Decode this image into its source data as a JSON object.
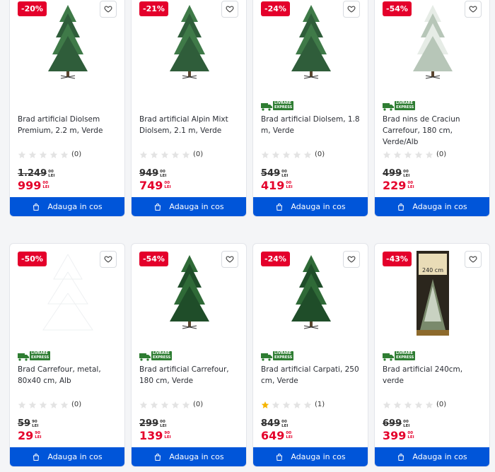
{
  "products": [
    {
      "discount": "-20%",
      "title": "Brad artificial Diolsem Premium, 2.2 m, Verde",
      "delivery": false,
      "rating": 0,
      "reviews": "(0)",
      "old_int": "1.249",
      "old_dec": "00",
      "new_int": "999",
      "new_dec": "00",
      "currency": "LEI",
      "cart_label": "Adauga in cos",
      "image": "green-fir"
    },
    {
      "discount": "-21%",
      "title": "Brad artificial Alpin Mixt Diolsem, 2.1 m, Verde",
      "delivery": false,
      "rating": 0,
      "reviews": "(0)",
      "old_int": "949",
      "old_dec": "00",
      "new_int": "749",
      "new_dec": "00",
      "currency": "LEI",
      "cart_label": "Adauga in cos",
      "image": "green-fir"
    },
    {
      "discount": "-24%",
      "title": "Brad artificial Diolsem, 1.8 m, Verde",
      "delivery": true,
      "rating": 0,
      "reviews": "(0)",
      "old_int": "549",
      "old_dec": "00",
      "new_int": "419",
      "new_dec": "00",
      "currency": "LEI",
      "cart_label": "Adauga in cos",
      "image": "green-fir"
    },
    {
      "discount": "-54%",
      "title": "Brad nins de Craciun Carrefour, 180 cm, Verde/Alb",
      "delivery": true,
      "rating": 0,
      "reviews": "(0)",
      "old_int": "499",
      "old_dec": "00",
      "new_int": "229",
      "new_dec": "00",
      "currency": "LEI",
      "cart_label": "Adauga in cos",
      "image": "snow-fir"
    },
    {
      "discount": "-50%",
      "title": "Brad Carrefour, metal, 80x40 cm, Alb",
      "delivery": true,
      "rating": 0,
      "reviews": "(0)",
      "old_int": "59",
      "old_dec": "90",
      "new_int": "29",
      "new_dec": "90",
      "currency": "LEI",
      "cart_label": "Adauga in cos",
      "image": "metal-tree"
    },
    {
      "discount": "-54%",
      "title": "Brad artificial Carrefour, 180 cm, Verde",
      "delivery": true,
      "rating": 0,
      "reviews": "(0)",
      "old_int": "299",
      "old_dec": "00",
      "new_int": "139",
      "new_dec": "90",
      "currency": "LEI",
      "cart_label": "Adauga in cos",
      "image": "dark-fir"
    },
    {
      "discount": "-24%",
      "title": "Brad artificial Carpati, 250 cm, Verde",
      "delivery": true,
      "rating": 1,
      "reviews": "(1)",
      "old_int": "849",
      "old_dec": "00",
      "new_int": "649",
      "new_dec": "00",
      "currency": "LEI",
      "cart_label": "Adauga in cos",
      "image": "dark-fir"
    },
    {
      "discount": "-43%",
      "title": "Brad artificial 240cm, verde",
      "delivery": true,
      "rating": 0,
      "reviews": "(0)",
      "old_int": "699",
      "old_dec": "00",
      "new_int": "399",
      "new_dec": "00",
      "currency": "LEI",
      "cart_label": "Adauga in cos",
      "image": "boxed-tree",
      "box_text": "240 cm"
    }
  ],
  "delivery_badge": {
    "line1": "LIVRARE",
    "line2": "EXPRESS"
  },
  "colors": {
    "discount": "#e4002b",
    "new_price": "#e4002b",
    "cart_button": "#0055d9",
    "delivery_badge": "#2e7d32",
    "star_filled": "#f5b400",
    "star_empty": "#e3e3e3"
  }
}
